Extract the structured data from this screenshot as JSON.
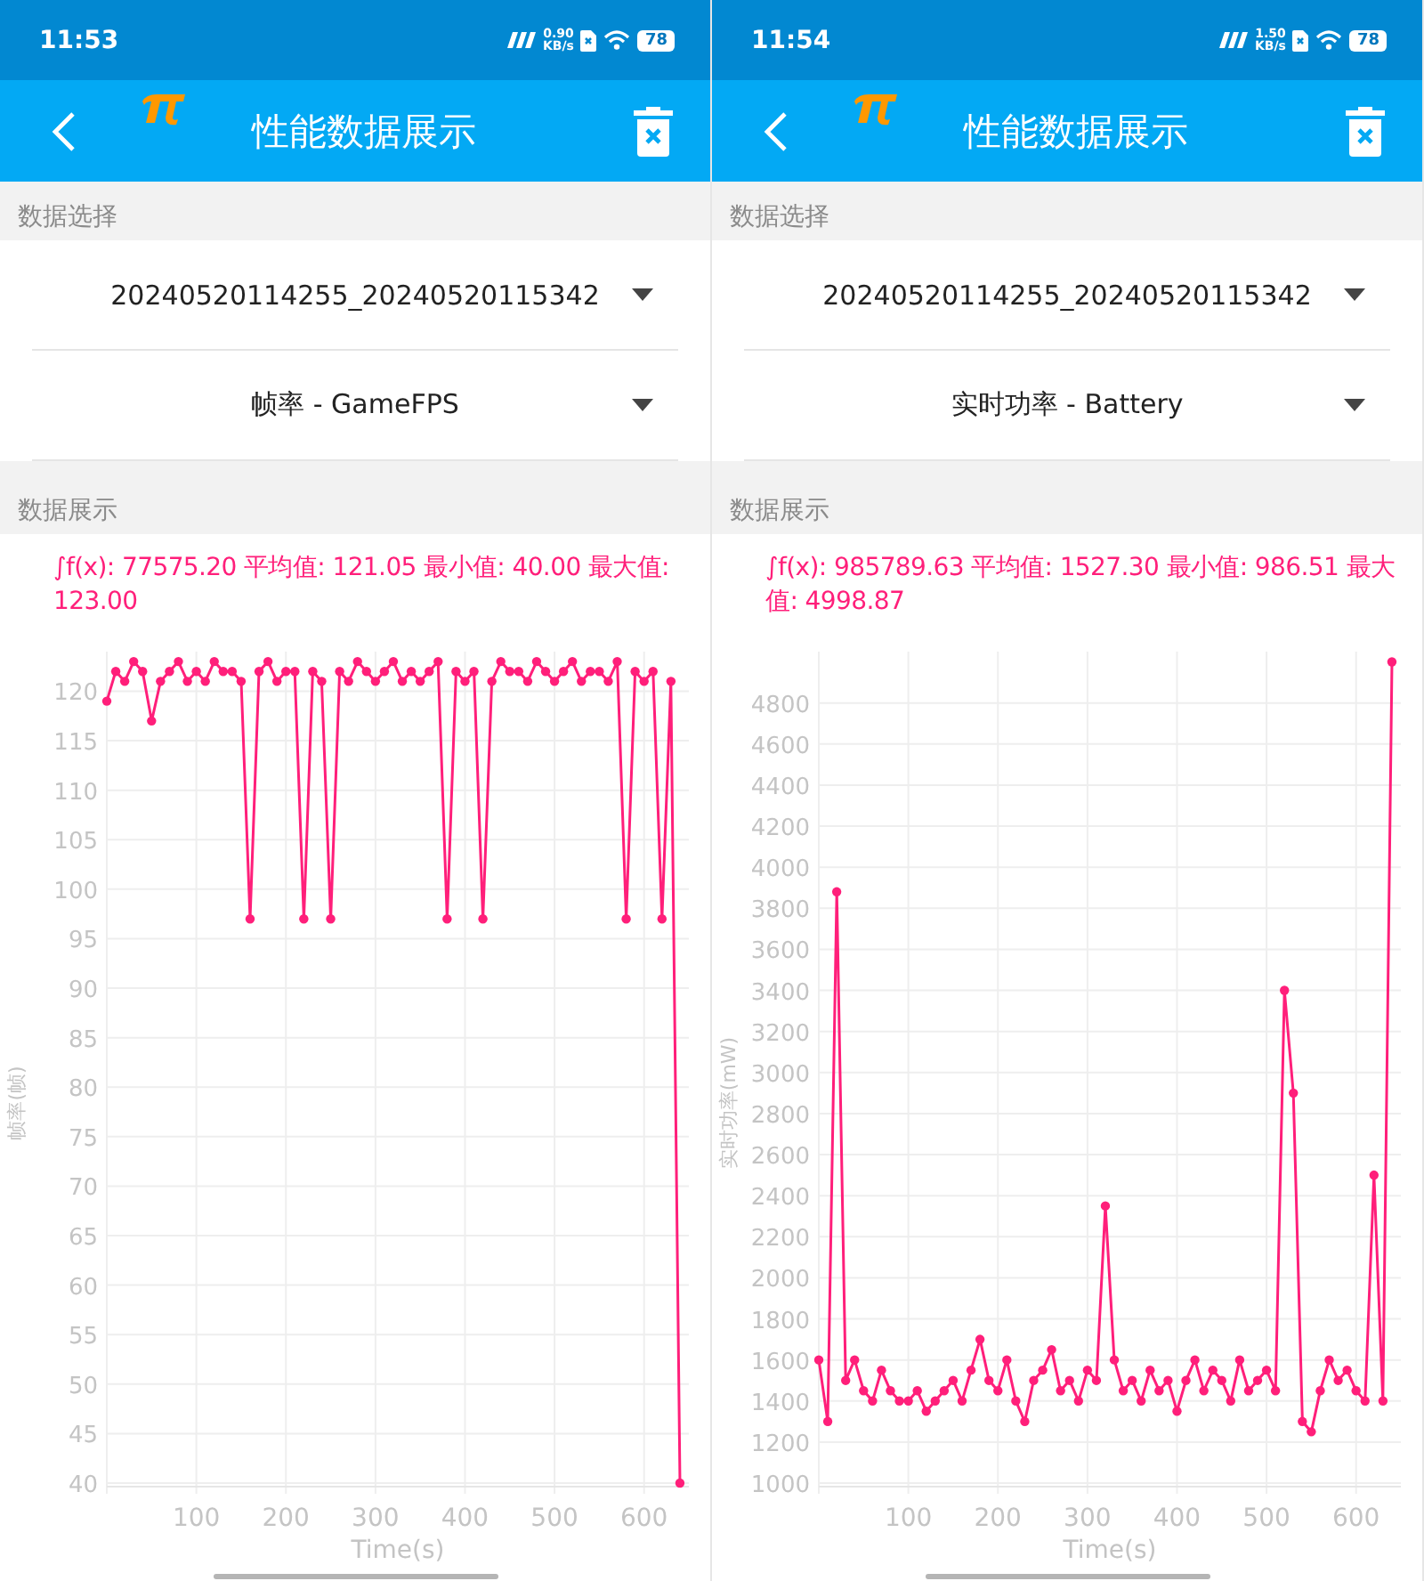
{
  "phones": [
    {
      "status_bar": {
        "time": "11:53",
        "net_speed": "0.90",
        "net_unit": "KB/s",
        "battery": "78"
      },
      "app_bar": {
        "title": "性能数据展示"
      },
      "selection": {
        "header": "数据选择",
        "file": "20240520114255_20240520115342",
        "metric": "帧率 - GameFPS"
      },
      "display": {
        "header": "数据展示",
        "summary": "∫f(x): 77575.20 平均值: 121.05 最小值: 40.00 最大值: 123.00",
        "chart_data": {
          "type": "line",
          "xlabel": "Time(s)",
          "ylabel": "帧率(帧)",
          "xlim": [
            0,
            650
          ],
          "ylim": [
            40,
            124
          ],
          "xticks": [
            100,
            200,
            300,
            400,
            500,
            600
          ],
          "yticks": [
            40,
            45,
            50,
            55,
            60,
            65,
            70,
            75,
            80,
            85,
            90,
            95,
            100,
            105,
            110,
            115,
            120
          ],
          "x": [
            0,
            10,
            20,
            30,
            40,
            50,
            60,
            70,
            80,
            90,
            100,
            110,
            120,
            130,
            140,
            150,
            160,
            170,
            180,
            190,
            200,
            210,
            220,
            230,
            240,
            250,
            260,
            270,
            280,
            290,
            300,
            310,
            320,
            330,
            340,
            350,
            360,
            370,
            380,
            390,
            400,
            410,
            420,
            430,
            440,
            450,
            460,
            470,
            480,
            490,
            500,
            510,
            520,
            530,
            540,
            550,
            560,
            570,
            580,
            590,
            600,
            610,
            620,
            630,
            640
          ],
          "grid": true,
          "series": [
            {
              "color": "#ff1f7a",
              "marker": true,
              "values": [
                119,
                122,
                121,
                123,
                122,
                117,
                121,
                122,
                123,
                121,
                122,
                121,
                123,
                122,
                122,
                121,
                97,
                122,
                123,
                121,
                122,
                122,
                97,
                122,
                121,
                97,
                122,
                121,
                123,
                122,
                121,
                122,
                123,
                121,
                122,
                121,
                122,
                123,
                97,
                122,
                121,
                122,
                97,
                121,
                123,
                122,
                122,
                121,
                123,
                122,
                121,
                122,
                123,
                121,
                122,
                122,
                121,
                123,
                97,
                122,
                121,
                122,
                97,
                121,
                40
              ]
            }
          ]
        }
      }
    },
    {
      "status_bar": {
        "time": "11:54",
        "net_speed": "1.50",
        "net_unit": "KB/s",
        "battery": "78"
      },
      "app_bar": {
        "title": "性能数据展示"
      },
      "selection": {
        "header": "数据选择",
        "file": "20240520114255_20240520115342",
        "metric": "实时功率 - Battery"
      },
      "display": {
        "header": "数据展示",
        "summary": "∫f(x): 985789.63 平均值: 1527.30 最小值: 986.51 最大值: 4998.87",
        "chart_data": {
          "type": "line",
          "xlabel": "Time(s)",
          "ylabel": "实时功率(mW)",
          "xlim": [
            0,
            650
          ],
          "ylim": [
            1000,
            5050
          ],
          "xticks": [
            100,
            200,
            300,
            400,
            500,
            600
          ],
          "yticks": [
            1000,
            1200,
            1400,
            1600,
            1800,
            2000,
            2200,
            2400,
            2600,
            2800,
            3000,
            3200,
            3400,
            3600,
            3800,
            4000,
            4200,
            4400,
            4600,
            4800
          ],
          "x": [
            0,
            10,
            20,
            30,
            40,
            50,
            60,
            70,
            80,
            90,
            100,
            110,
            120,
            130,
            140,
            150,
            160,
            170,
            180,
            190,
            200,
            210,
            220,
            230,
            240,
            250,
            260,
            270,
            280,
            290,
            300,
            310,
            320,
            330,
            340,
            350,
            360,
            370,
            380,
            390,
            400,
            410,
            420,
            430,
            440,
            450,
            460,
            470,
            480,
            490,
            500,
            510,
            520,
            530,
            540,
            550,
            560,
            570,
            580,
            590,
            600,
            610,
            620,
            630,
            640
          ],
          "grid": true,
          "series": [
            {
              "color": "#ff1f7a",
              "marker": true,
              "values": [
                1600,
                1300,
                3880,
                1500,
                1600,
                1450,
                1400,
                1550,
                1450,
                1400,
                1400,
                1450,
                1350,
                1400,
                1450,
                1500,
                1400,
                1550,
                1700,
                1500,
                1450,
                1600,
                1400,
                1300,
                1500,
                1550,
                1650,
                1450,
                1500,
                1400,
                1550,
                1500,
                2350,
                1600,
                1450,
                1500,
                1400,
                1550,
                1450,
                1500,
                1350,
                1500,
                1600,
                1450,
                1550,
                1500,
                1400,
                1600,
                1450,
                1500,
                1550,
                1450,
                3400,
                2900,
                1300,
                1250,
                1450,
                1600,
                1500,
                1550,
                1450,
                1400,
                2500,
                1400,
                5000
              ]
            }
          ]
        }
      }
    }
  ]
}
